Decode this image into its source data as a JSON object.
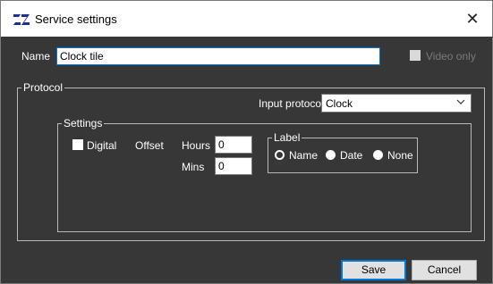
{
  "window": {
    "title": "Service settings",
    "logo_icon": "zz-logo-icon",
    "close_icon": "close-icon",
    "close_glyph": "✕"
  },
  "name_row": {
    "label": "Name",
    "value": "Clock tile",
    "video_only_label": "Video only",
    "video_only_checked": false,
    "video_only_enabled": false
  },
  "protocol": {
    "legend": "Protocol",
    "input_protocol_label": "Input protocol",
    "input_protocol_value": "Clock",
    "settings": {
      "legend": "Settings",
      "digital_label": "Digital",
      "digital_checked": false,
      "offset_label": "Offset",
      "hours_label": "Hours",
      "hours_value": "0",
      "mins_label": "Mins",
      "mins_value": "0",
      "label_group": {
        "legend": "Label",
        "options": [
          "Name",
          "Date",
          "None"
        ],
        "selected": "Name"
      }
    }
  },
  "footer": {
    "save_label": "Save",
    "cancel_label": "Cancel"
  },
  "colors": {
    "dialog_bg": "#373737",
    "accent": "#0078d7",
    "text": "#ffffff",
    "disabled_text": "#7a7a7a"
  }
}
